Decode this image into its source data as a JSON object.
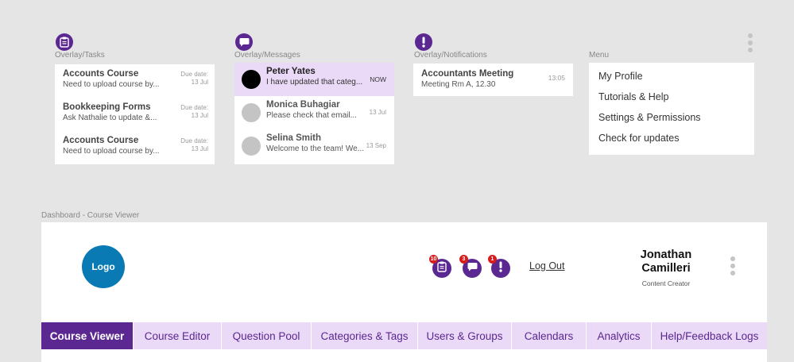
{
  "overlays": {
    "tasks": {
      "label": "Overlay/Tasks",
      "items": [
        {
          "title": "Accounts Course",
          "desc": "Need to upload course by...",
          "due_label": "Due date:",
          "due_date": "13 Jul"
        },
        {
          "title": "Bookkeeping Forms",
          "desc": "Ask Nathalie to update &...",
          "due_label": "Due date:",
          "due_date": "13 Jul"
        },
        {
          "title": "Accounts Course",
          "desc": "Need to upload course by...",
          "due_label": "Due date:",
          "due_date": "13 Jul"
        }
      ]
    },
    "messages": {
      "label": "Overlay/Messages",
      "items": [
        {
          "name": "Peter Yates",
          "text": "I have updated that categ...",
          "time": "NOW",
          "unread": true
        },
        {
          "name": "Monica Buhagiar",
          "text": "Please check that email...",
          "time": "13 Jul",
          "unread": false
        },
        {
          "name": "Selina Smith",
          "text": "Welcome to the team! We...",
          "time": "13 Sep",
          "unread": false
        }
      ]
    },
    "notifications": {
      "label": "Overlay/Notifications",
      "items": [
        {
          "title": "Accountants Meeting",
          "sub": "Meeting Rm A, 12.30",
          "time": "13:05"
        }
      ]
    },
    "menu": {
      "label": "Menu",
      "items": [
        "My Profile",
        "Tutorials & Help",
        "Settings & Permissions",
        "Check for updates"
      ]
    }
  },
  "dashboard": {
    "frame_label": "Dashboard - Course Viewer",
    "logo": "Logo",
    "badges": {
      "tasks": "10",
      "messages": "3",
      "notifications": "1"
    },
    "logout": "Log Out",
    "user": {
      "name_line1": "Jonathan",
      "name_line2": "Camilleri",
      "role": "Content Creator"
    },
    "tabs": [
      "Course Viewer",
      "Course Editor",
      "Question Pool",
      "Categories & Tags",
      "Users & Groups",
      "Calendars",
      "Analytics",
      "Help/Feedback Logs"
    ],
    "active_tab": "Course Viewer"
  },
  "colors": {
    "accent": "#5b2791",
    "accent_light": "#eadaf7",
    "logo": "#0a7ab5",
    "badge": "#d81b1b"
  },
  "icons": [
    "clipboard-icon",
    "chat-bubble-icon",
    "exclamation-icon",
    "kebab-menu-icon"
  ]
}
